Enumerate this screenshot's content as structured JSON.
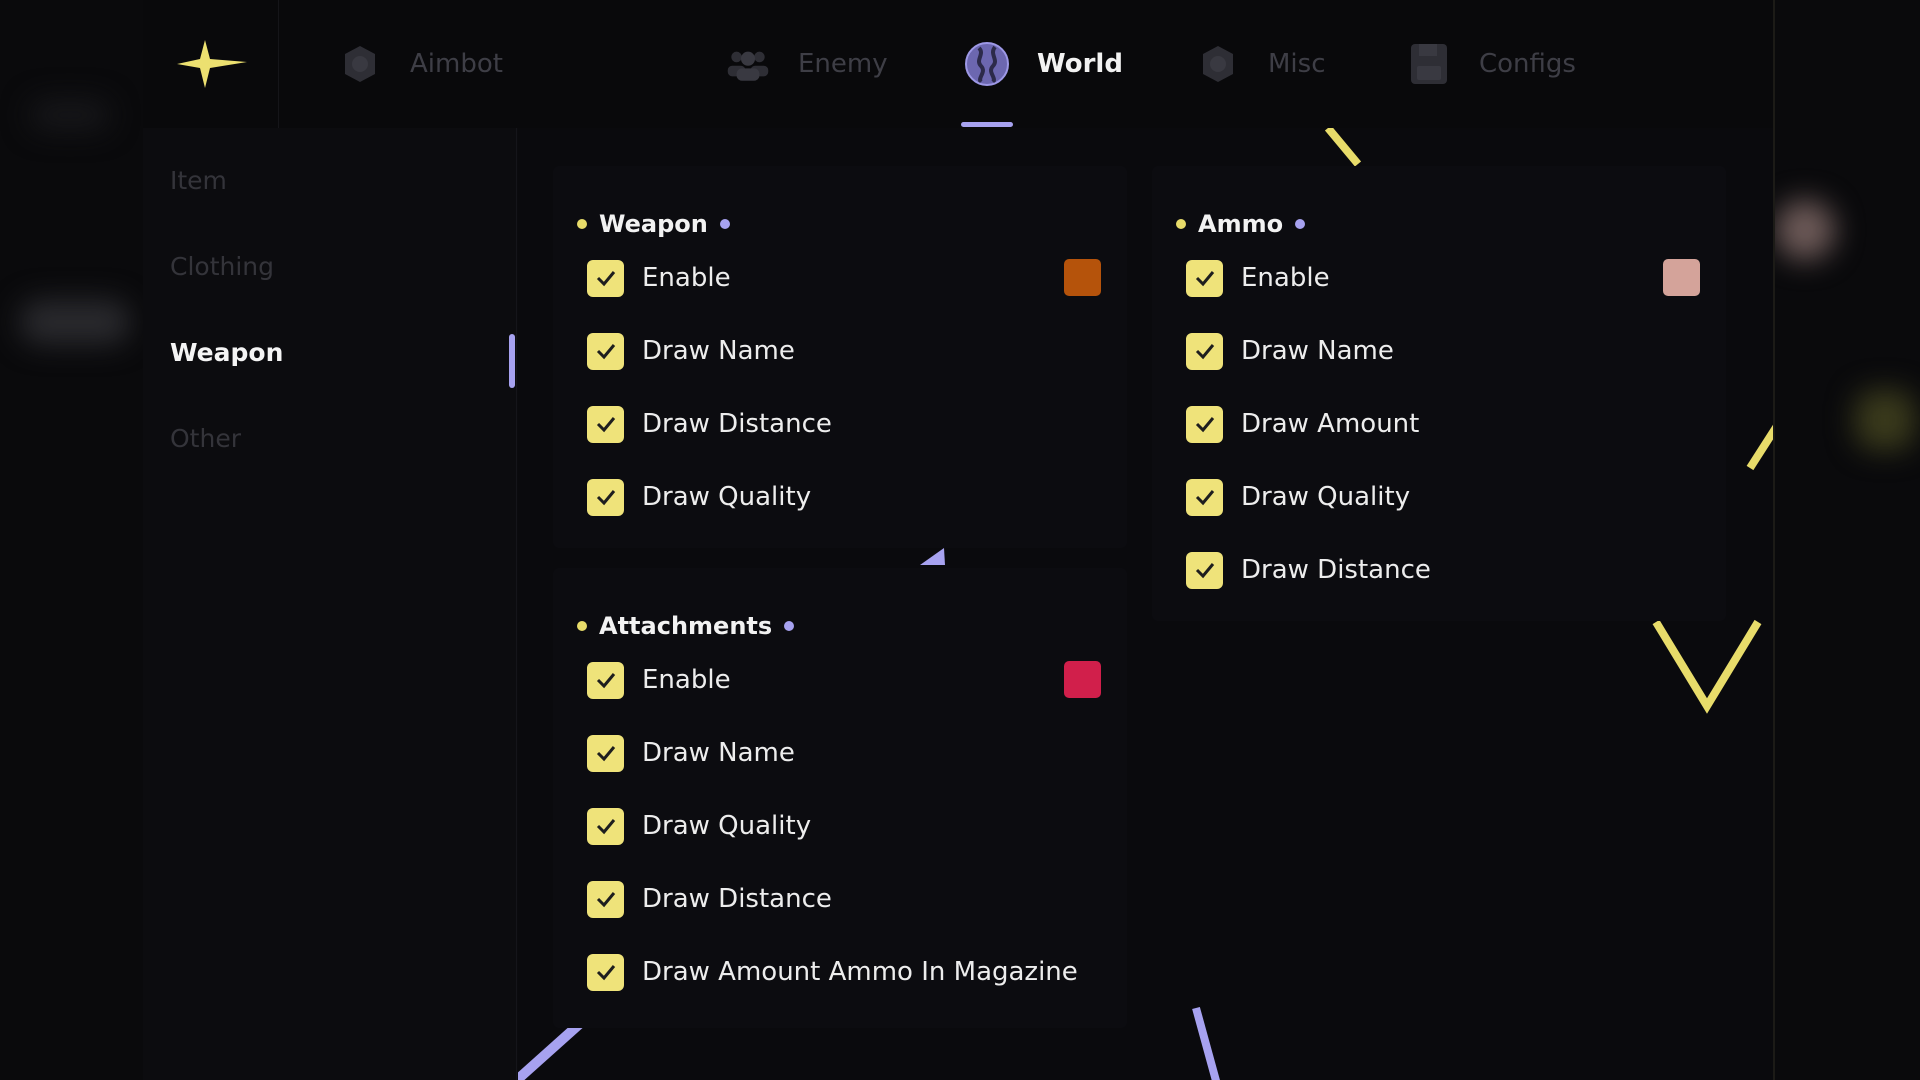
{
  "app": {
    "accent": "#a7a2f0",
    "check_color": "#efe37a"
  },
  "tabs": [
    {
      "label": "Aimbot",
      "icon": "chip-icon",
      "active": false
    },
    {
      "label": "Enemy",
      "icon": "users-icon",
      "active": false
    },
    {
      "label": "World",
      "icon": "globe-icon",
      "active": true
    },
    {
      "label": "Misc",
      "icon": "chip-icon",
      "active": false
    },
    {
      "label": "Configs",
      "icon": "floppy-disk-icon",
      "active": false
    }
  ],
  "sidebar": {
    "items": [
      {
        "label": "Item",
        "active": false
      },
      {
        "label": "Clothing",
        "active": false
      },
      {
        "label": "Weapon",
        "active": true
      },
      {
        "label": "Other",
        "active": false
      }
    ]
  },
  "panels": {
    "weapon": {
      "title": "Weapon",
      "enable_color": "#b5530b",
      "rows": [
        {
          "label": "Enable",
          "checked": true
        },
        {
          "label": "Draw Name",
          "checked": true
        },
        {
          "label": "Draw Distance",
          "checked": true
        },
        {
          "label": "Draw Quality",
          "checked": true
        }
      ]
    },
    "attachments": {
      "title": "Attachments",
      "enable_color": "#d11f4b",
      "rows": [
        {
          "label": "Enable",
          "checked": true
        },
        {
          "label": "Draw Name",
          "checked": true
        },
        {
          "label": "Draw Quality",
          "checked": true
        },
        {
          "label": "Draw Distance",
          "checked": true
        },
        {
          "label": "Draw Amount Ammo In Magazine",
          "checked": true
        }
      ]
    },
    "ammo": {
      "title": "Ammo",
      "enable_color": "#d4a39a",
      "rows": [
        {
          "label": "Enable",
          "checked": true
        },
        {
          "label": "Draw Name",
          "checked": true
        },
        {
          "label": "Draw Amount",
          "checked": true
        },
        {
          "label": "Draw Quality",
          "checked": true
        },
        {
          "label": "Draw Distance",
          "checked": true
        }
      ]
    }
  }
}
